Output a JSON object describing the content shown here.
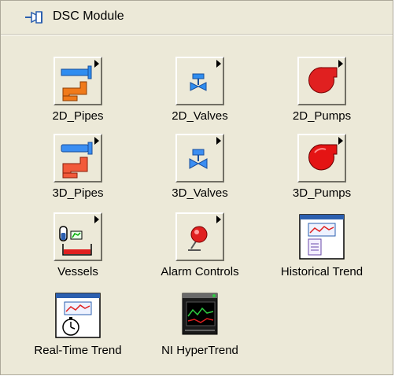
{
  "header": {
    "title": "DSC Module",
    "icon": "pin-icon"
  },
  "items": [
    {
      "label": "2D_Pipes",
      "icon": "2d-pipes-icon",
      "submenu": true
    },
    {
      "label": "2D_Valves",
      "icon": "2d-valves-icon",
      "submenu": true
    },
    {
      "label": "2D_Pumps",
      "icon": "2d-pumps-icon",
      "submenu": true
    },
    {
      "label": "3D_Pipes",
      "icon": "3d-pipes-icon",
      "submenu": true
    },
    {
      "label": "3D_Valves",
      "icon": "3d-valves-icon",
      "submenu": true
    },
    {
      "label": "3D_Pumps",
      "icon": "3d-pumps-icon",
      "submenu": true
    },
    {
      "label": "Vessels",
      "icon": "vessels-icon",
      "submenu": true
    },
    {
      "label": "Alarm Controls",
      "icon": "alarm-controls-icon",
      "submenu": true
    },
    {
      "label": "Historical Trend",
      "icon": "historical-trend-icon",
      "submenu": false
    },
    {
      "label": "Real-Time Trend",
      "icon": "real-time-trend-icon",
      "submenu": false
    },
    {
      "label": "NI HyperTrend",
      "icon": "ni-hypertrend-icon",
      "submenu": false
    }
  ]
}
